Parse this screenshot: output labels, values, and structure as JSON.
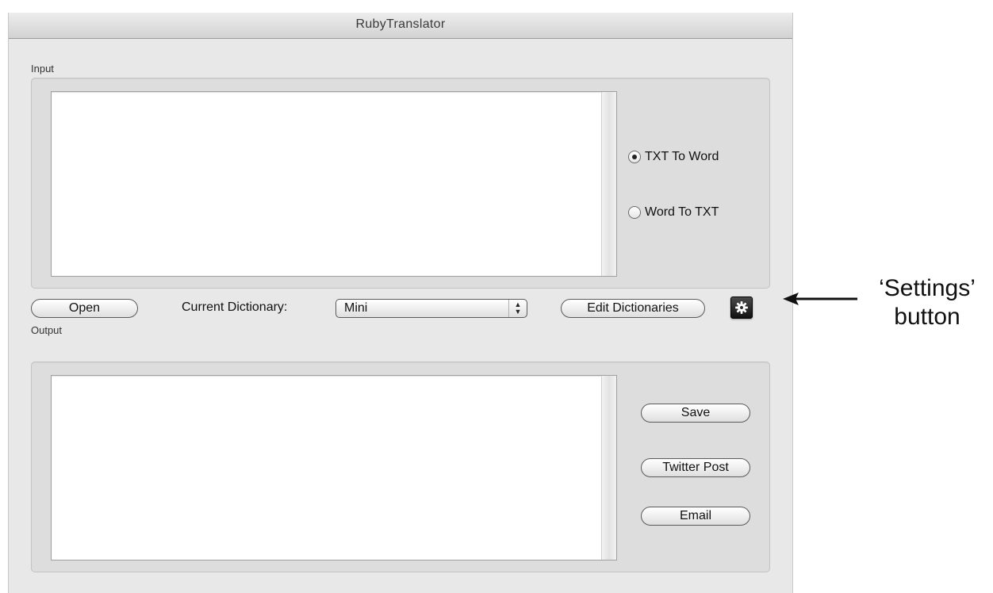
{
  "window": {
    "title": "RubyTranslator"
  },
  "input": {
    "group_label": "Input",
    "text": "",
    "modes": [
      {
        "label": "TXT To Word",
        "selected": true
      },
      {
        "label": "Word To TXT",
        "selected": false
      }
    ]
  },
  "toolbar": {
    "open_label": "Open",
    "dictionary_label": "Current Dictionary:",
    "dictionary_selected": "Mini",
    "edit_dictionaries_label": "Edit Dictionaries",
    "settings_icon": "gear-icon"
  },
  "output": {
    "group_label": "Output",
    "text": "",
    "buttons": {
      "save_label": "Save",
      "twitter_label": "Twitter Post",
      "email_label": "Email"
    }
  },
  "annotation": {
    "line1": "‘Settings’",
    "line2": "button"
  }
}
